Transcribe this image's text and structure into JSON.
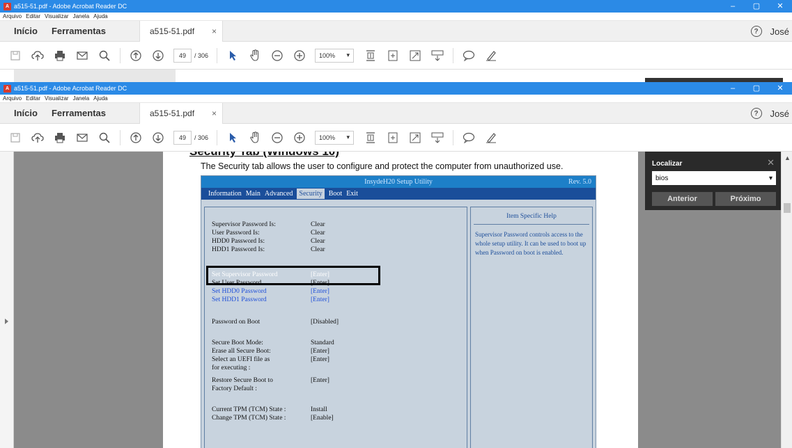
{
  "window": {
    "title": "a515-51.pdf - Adobe Acrobat Reader DC",
    "controls": [
      "–",
      "▢",
      "✕"
    ]
  },
  "menu": [
    "Arquivo",
    "Editar",
    "Visualizar",
    "Janela",
    "Ajuda"
  ],
  "nav": {
    "home": "Início",
    "tools": "Ferramentas"
  },
  "doc_tab": {
    "label": "a515-51.pdf",
    "close": "×"
  },
  "user": {
    "help": "?",
    "name": "José",
    "caret": "▾"
  },
  "toolbar": {
    "page_current": "49",
    "page_total": "/ 306",
    "zoom": "100%",
    "zoom_caret": "▾"
  },
  "document": {
    "section_heading": "Security Tab (Windows 10)",
    "description": "The Security tab allows the user to configure and protect the computer from unauthorized use.",
    "bios": {
      "title": "InsydeH20 Setup Utility",
      "rev": "Rev. 5.0",
      "menu": [
        "Information",
        "Main",
        "Advanced",
        "Security",
        "Boot",
        "Exit"
      ],
      "active_menu": "Security",
      "rows": [
        {
          "label": "Supervisor Password Is:",
          "value": "Clear",
          "style": "normal"
        },
        {
          "label": "User Password Is:",
          "value": "Clear",
          "style": "normal"
        },
        {
          "label": "HDD0 Password Is:",
          "value": "Clear",
          "style": "normal"
        },
        {
          "label": "HDD1 Password Is:",
          "value": "Clear",
          "style": "normal"
        },
        {
          "label": "Set Supervisor Password",
          "value": "[Enter]",
          "style": "white"
        },
        {
          "label": "Set User Password",
          "value": "[Enter]",
          "style": "normal"
        },
        {
          "label": "Set HDD0  Password",
          "value": "[Enter]",
          "style": "blue"
        },
        {
          "label": "Set HDD1  Password",
          "value": "[Enter]",
          "style": "blue"
        },
        {
          "label": "Password on Boot",
          "value": "[Disabled]",
          "style": "normal"
        },
        {
          "label": "Secure Boot Mode:",
          "value": "Standard",
          "style": "normal"
        },
        {
          "label": "Erase all Secure Boot:",
          "value": "[Enter]",
          "style": "normal"
        },
        {
          "label": "Select an UEFI file as",
          "value": "[Enter]",
          "style": "normal"
        },
        {
          "label": "for executing :",
          "value": "",
          "style": "normal"
        },
        {
          "label": "Restore Secure Boot to",
          "value": "[Enter]",
          "style": "normal"
        },
        {
          "label": "Factory Default :",
          "value": "",
          "style": "normal"
        },
        {
          "label": "Current TPM (TCM) State :",
          "value": "Install",
          "style": "normal"
        },
        {
          "label": "Change TPM (TCM) State :",
          "value": "[Enable]",
          "style": "normal"
        }
      ],
      "help_title": "Item Specific Help",
      "help_text": "Supervisor Password controls access to the whole setup utility. It can be used to boot up when Password on boot is enabled."
    }
  },
  "find": {
    "title": "Localizar",
    "query": "bios",
    "close": "✕",
    "prev": "Anterior",
    "next": "Próximo"
  }
}
